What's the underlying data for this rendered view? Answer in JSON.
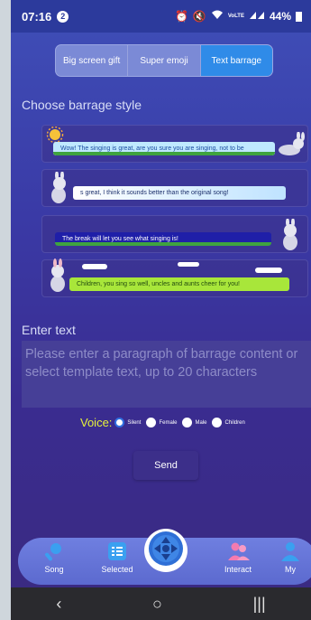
{
  "status_bar": {
    "time": "07:16",
    "notification_count": "2",
    "battery": "44%",
    "network": "VoLTE"
  },
  "tabs": [
    {
      "label": "Big screen gift",
      "active": false
    },
    {
      "label": "Super emoji",
      "active": false
    },
    {
      "label": "Text barrage",
      "active": true
    }
  ],
  "choose_style": {
    "title": "Choose barrage style",
    "templates": [
      "Wow! The singing is great, are you sure you are singing, not to be",
      "s great, I think it sounds better than the original song!",
      "The break will let you see what singing is!",
      "Children, you sing so well, uncles and aunts cheer for you!"
    ]
  },
  "enter_text": {
    "title": "Enter text",
    "placeholder": "Please enter a paragraph of barrage content or select template text, up to 20 characters"
  },
  "voice": {
    "label": "Voice:",
    "options": [
      {
        "label": "Silent",
        "selected": true
      },
      {
        "label": "Female",
        "selected": false
      },
      {
        "label": "Male",
        "selected": false
      },
      {
        "label": "Children",
        "selected": false
      }
    ]
  },
  "send_label": "Send",
  "bottom_nav": {
    "items": [
      {
        "label": "Song",
        "icon": "microphone-icon"
      },
      {
        "label": "Selected",
        "icon": "song-list-icon"
      },
      {
        "label": "Interact",
        "icon": "people-icon"
      },
      {
        "label": "My",
        "icon": "person-icon"
      }
    ],
    "center_icon": "play-control-icon"
  },
  "colors": {
    "accent": "#2f8be8",
    "voice_label": "#e6f23a",
    "background": "#3a3aa6"
  }
}
